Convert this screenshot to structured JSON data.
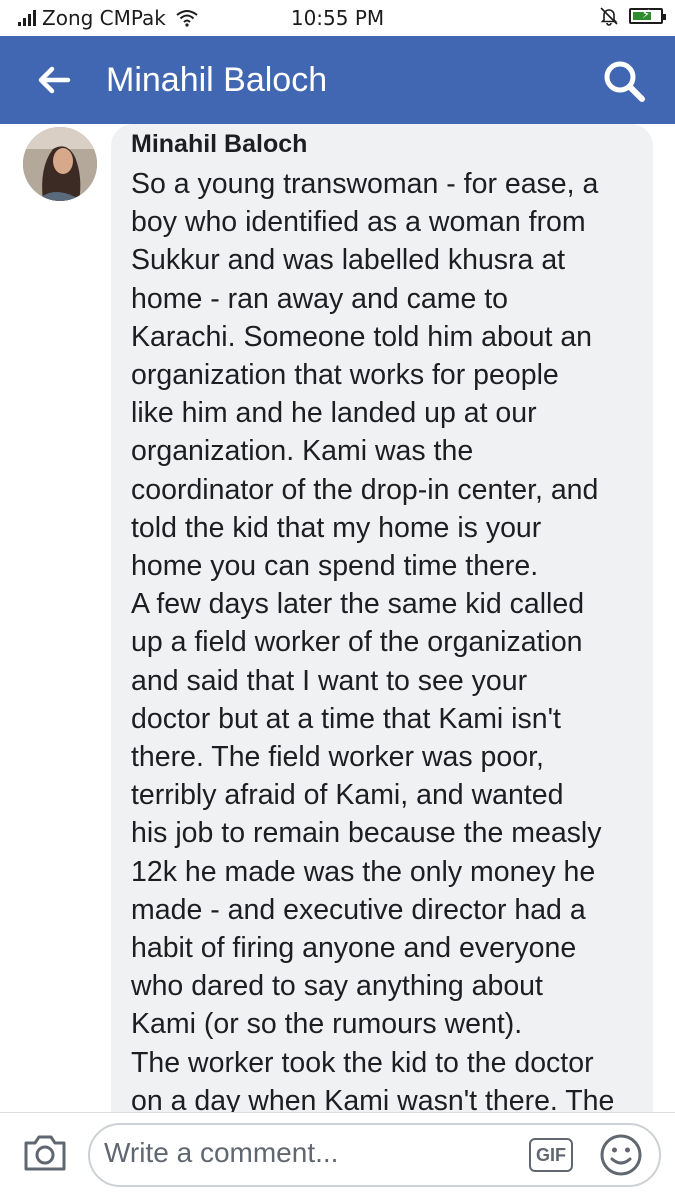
{
  "status_bar": {
    "carrier": "Zong CMPak",
    "time": "10:55 PM",
    "battery_level": 0.7,
    "icons": [
      "signal-icon",
      "wifi-icon",
      "alarm-icon",
      "battery-charging-icon"
    ]
  },
  "app_bar": {
    "title": "Minahil Baloch",
    "back_icon": "back-arrow-icon",
    "search_icon": "search-icon",
    "color": "#4267b2"
  },
  "comment": {
    "author": "Minahil Baloch",
    "lines": [
      "So a young transwoman - for ease, a",
      "boy who identified as a woman from",
      "Sukkur and was labelled khusra at",
      "home - ran away and came to",
      "Karachi. Someone told him about an",
      "organization that works for people",
      "like him and he landed up at our",
      "organization. Kami was the",
      "coordinator of the drop-in center, and",
      "told the kid that my home is your",
      "home you can spend time there.",
      "A few days later the same kid called",
      "up a field worker of the organization",
      "and said that I want to see your",
      "doctor but at a time that Kami isn't",
      "there. The field worker was poor,",
      "terribly afraid of Kami, and wanted",
      "his job to remain because the measly",
      "12k he made was the only money he",
      "made - and executive director had a",
      "habit of firing anyone and everyone",
      "who dared to say anything about",
      "Kami (or so the rumours went).",
      "The worker took the kid to the doctor",
      "on a day when Kami wasn't there. The"
    ]
  },
  "composer": {
    "placeholder": "Write a comment...",
    "gif_label": "GIF",
    "camera_icon": "camera-icon",
    "emoji_icon": "emoji-icon"
  }
}
